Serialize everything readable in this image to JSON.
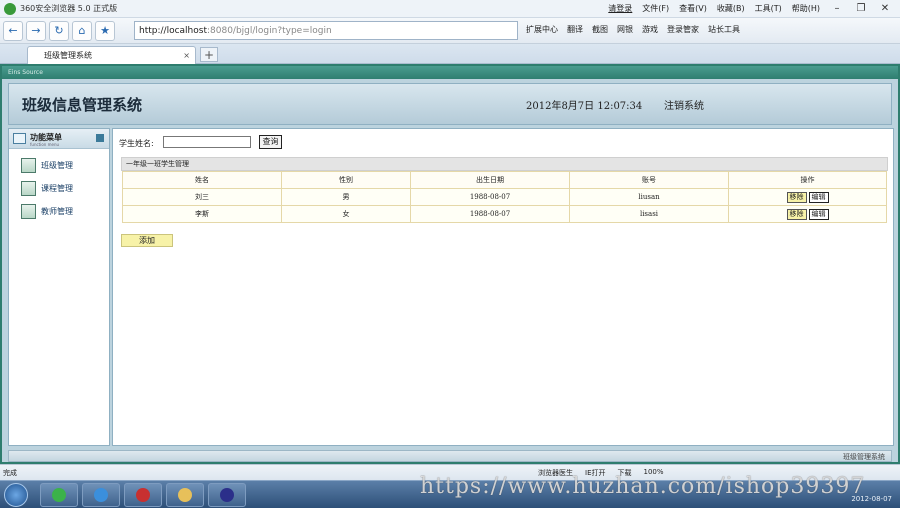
{
  "browser": {
    "title": "360安全浏览器 5.0 正式版",
    "menus": [
      "文件(F)",
      "查看(V)",
      "收藏(B)",
      "工具(T)",
      "帮助(H)"
    ],
    "login_link": "请登录",
    "address_host": "http://localhost",
    "address_rest": ":8080/bjgl/login?type=login",
    "tools": [
      "扩展中心",
      "翻译",
      "截图",
      "网银",
      "游戏",
      "登录管家",
      "站长工具"
    ],
    "tab_title": "班级管理系统",
    "tab_close": "×",
    "new_tab": "+"
  },
  "app": {
    "strip_text": "Eins Source",
    "title": "班级信息管理系统",
    "datetime": "2012年8月7日  12:07:34",
    "logout": "注销系统",
    "footer_name": "班级管理系统"
  },
  "sidebar": {
    "header": "功能菜单",
    "header_sub": "function menu",
    "items": [
      {
        "label": "班级管理"
      },
      {
        "label": "课程管理"
      },
      {
        "label": "教师管理"
      }
    ]
  },
  "search": {
    "label": "学生姓名:",
    "value": "",
    "button": "查询"
  },
  "table": {
    "caption": "一年级一班学生管理",
    "headers": [
      "姓名",
      "性别",
      "出生日期",
      "账号",
      "操作"
    ],
    "rows": [
      {
        "name": "刘三",
        "gender": "男",
        "birthday": "1988-08-07",
        "account": "liusan",
        "delete": "移除",
        "edit": "编辑"
      },
      {
        "name": "李斯",
        "gender": "女",
        "birthday": "1988-08-07",
        "account": "lisasi",
        "delete": "移除",
        "edit": "编辑"
      }
    ]
  },
  "add_button": "添加",
  "statusbar": {
    "left": "完成",
    "items": [
      "浏览器医生",
      "IE打开",
      "下载",
      "100%"
    ]
  },
  "taskbar": {
    "clock_date": "2012-08-07"
  },
  "watermark": "https://www.huzhan.com/ishop39397"
}
